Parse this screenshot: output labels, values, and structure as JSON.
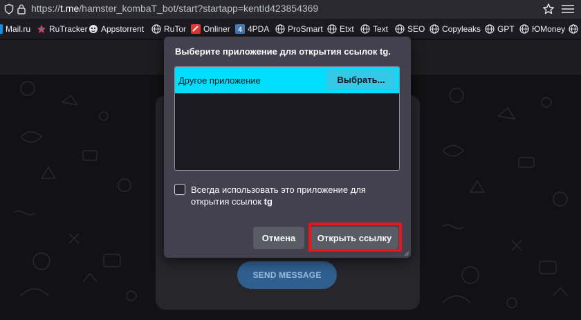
{
  "address_bar": {
    "url_prefix": "https://",
    "url_host": "t.me",
    "url_path": "/hamster_kombaT_bot/start?startapp=kentId423854369"
  },
  "bookmarks": [
    {
      "label": "Mail.ru",
      "icon": "mailru-icon"
    },
    {
      "label": "RuTracker",
      "icon": "rutracker-icon"
    },
    {
      "label": "Appstorrent",
      "icon": "appstorrent-icon"
    },
    {
      "label": "RuTor",
      "icon": "globe-icon"
    },
    {
      "label": "Onliner",
      "icon": "onliner-icon"
    },
    {
      "label": "4PDA",
      "icon": "4pda-icon"
    },
    {
      "label": "ProSmart",
      "icon": "globe-icon"
    },
    {
      "label": "Etxt",
      "icon": "globe-icon"
    },
    {
      "label": "Text",
      "icon": "globe-icon"
    },
    {
      "label": "SEO",
      "icon": "globe-icon"
    },
    {
      "label": "Copyleaks",
      "icon": "globe-icon"
    },
    {
      "label": "GPT",
      "icon": "globe-icon"
    },
    {
      "label": "ЮMoney",
      "icon": "globe-icon"
    }
  ],
  "page": {
    "send_button": "SEND MESSAGE"
  },
  "dialog": {
    "title": "Выберите приложение для открытия ссылок tg.",
    "app_list": [
      {
        "name": "Другое приложение",
        "action": "Выбрать..."
      }
    ],
    "always_use_text": "Всегда использовать это приложение для открытия ссылок ",
    "always_use_scheme": "tg",
    "always_use_checked": false,
    "cancel_button": "Отмена",
    "open_button": "Открыть ссылку"
  },
  "colors": {
    "selected_row": "#00ddff",
    "dialog_bg": "#42414d",
    "highlight_frame": "#e8151c",
    "send_button_bg": "#2f5f8f"
  }
}
